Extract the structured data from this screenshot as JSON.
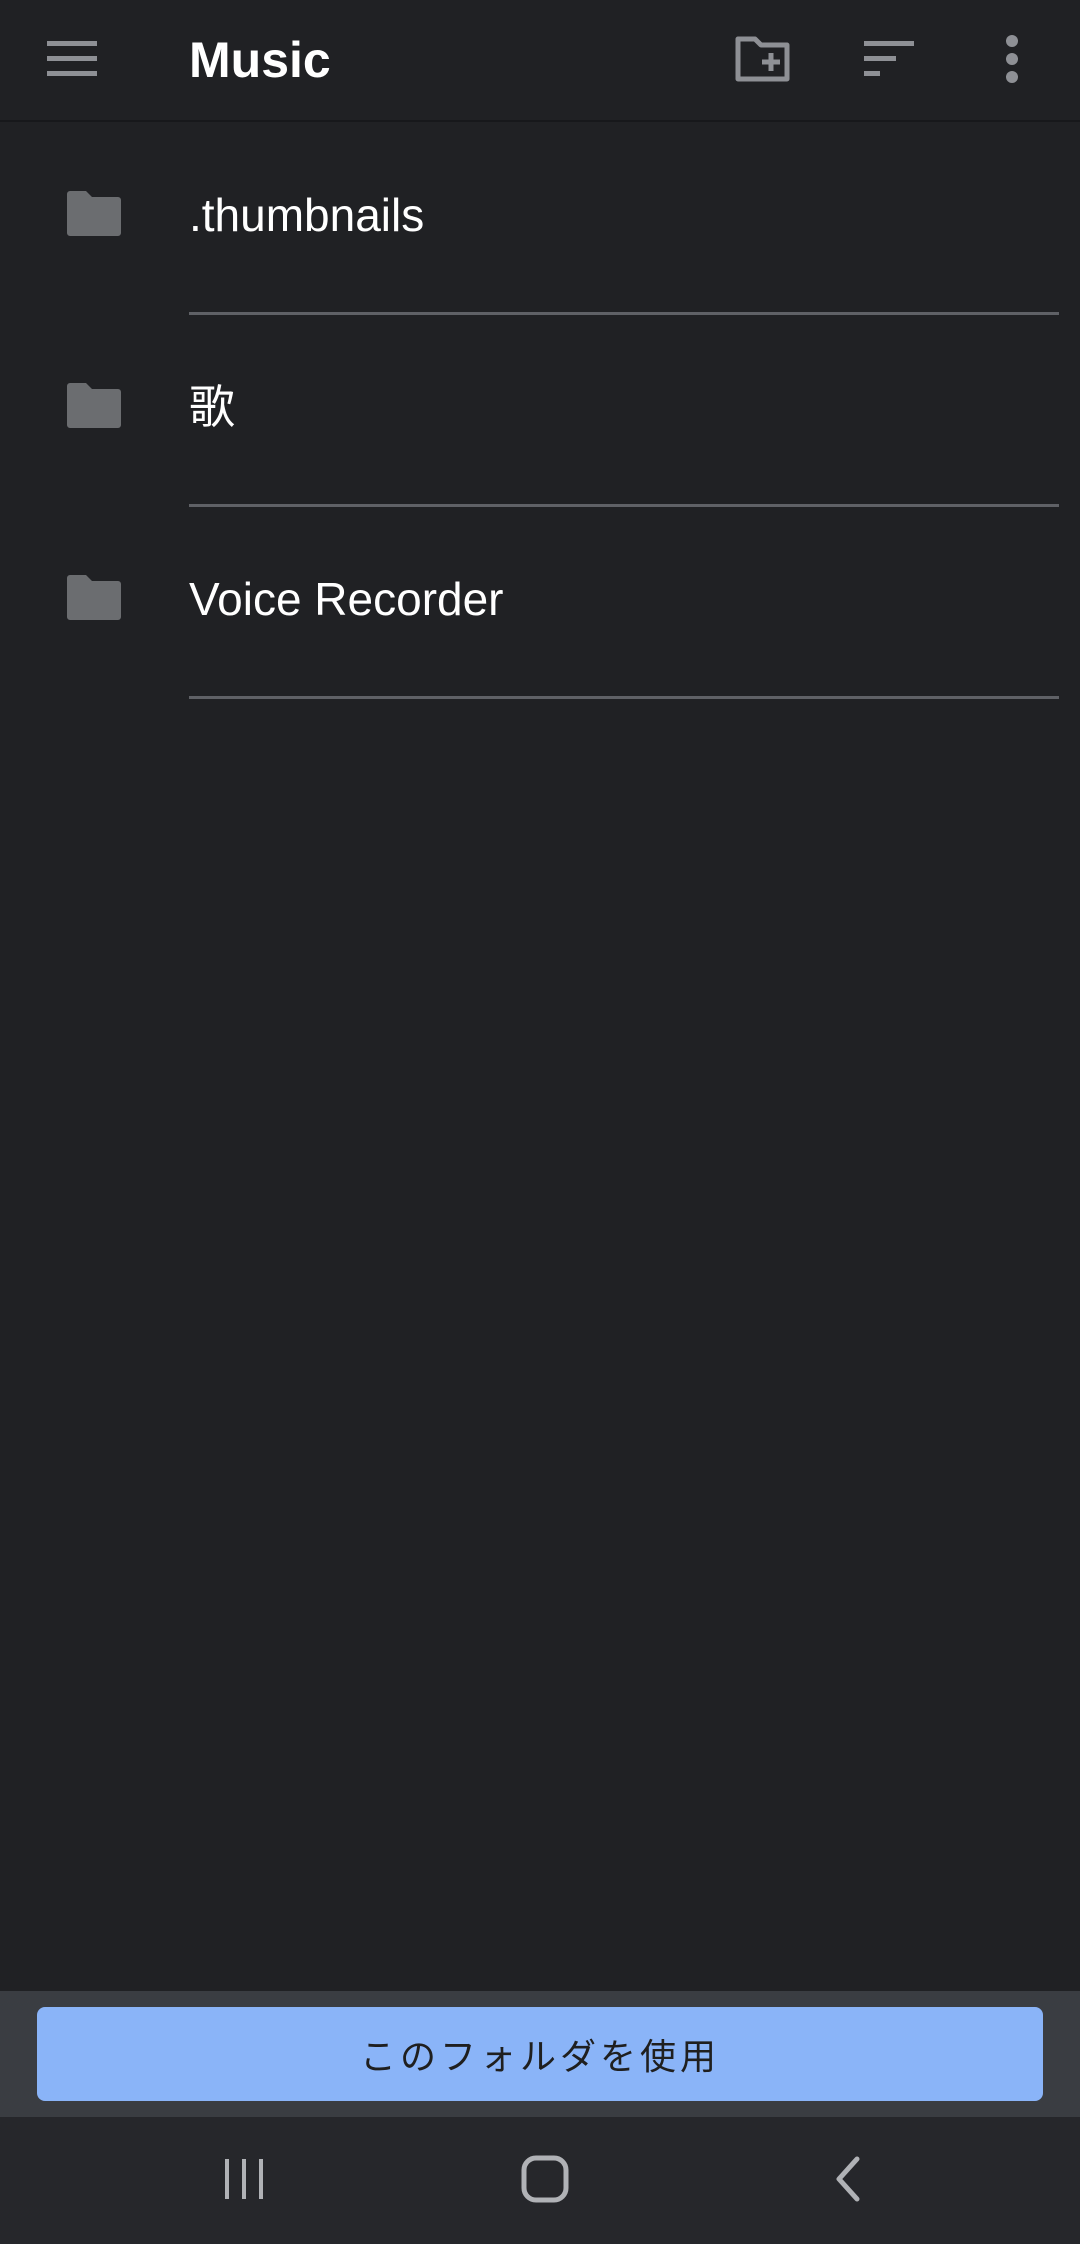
{
  "header": {
    "title": "Music",
    "icons": {
      "menu": "hamburger-menu-icon",
      "new_folder": "create-new-folder-icon",
      "sort": "sort-icon",
      "more": "more-vert-icon"
    }
  },
  "folders": [
    {
      "name": ".thumbnails",
      "icon": "folder-icon"
    },
    {
      "name": "歌",
      "icon": "folder-icon"
    },
    {
      "name": "Voice Recorder",
      "icon": "folder-icon"
    }
  ],
  "action": {
    "use_folder_label": "このフォルダを使用"
  },
  "system_nav": {
    "icons": [
      "recents-icon",
      "home-icon",
      "back-icon"
    ]
  },
  "colors": {
    "background": "#202124",
    "primary_button": "#8ab4f8",
    "icon_gray": "#8e9095",
    "divider": "#5f6166"
  }
}
